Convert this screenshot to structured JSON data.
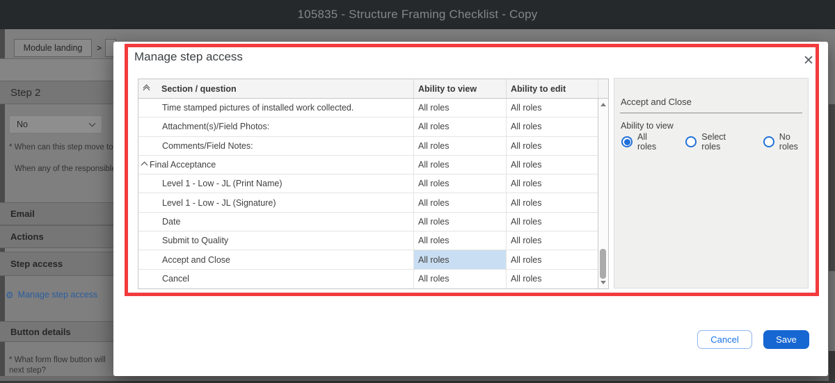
{
  "titlebar": {
    "title": "105835 - Structure Framing Checklist - Copy"
  },
  "background": {
    "breadcrumb": {
      "item": "Module landing",
      "separator": ">"
    },
    "step_heading": "Step 2",
    "dropdown_value": "No",
    "question_truncated": "* When can this step move to",
    "answer_truncated": "When any of the responsible",
    "section_email": "Email",
    "section_actions": "Actions",
    "section_step_access": "Step access",
    "manage_step_access_link": "Manage step access",
    "section_button_details": "Button details",
    "question2_line1": "* What form flow button will",
    "question2_line2": "next step?"
  },
  "icons": {
    "gear": "⚙",
    "close": "✕"
  },
  "modal": {
    "title": "Manage step access",
    "table": {
      "columns": [
        "Section / question",
        "Ability to view",
        "Ability to edit"
      ],
      "rows": [
        {
          "label": "Time stamped pictures of installed work collected.",
          "view": "All roles",
          "edit": "All roles",
          "section": false,
          "view_selected": false
        },
        {
          "label": "Attachment(s)/Field Photos:",
          "view": "All roles",
          "edit": "All roles",
          "section": false,
          "view_selected": false
        },
        {
          "label": "Comments/Field Notes:",
          "view": "All roles",
          "edit": "All roles",
          "section": false,
          "view_selected": false
        },
        {
          "label": "Final Acceptance",
          "view": "All roles",
          "edit": "All roles",
          "section": true,
          "view_selected": false
        },
        {
          "label": "Level 1 - Low - JL (Print Name)",
          "view": "All roles",
          "edit": "All roles",
          "section": false,
          "view_selected": false
        },
        {
          "label": "Level 1 - Low - JL (Signature)",
          "view": "All roles",
          "edit": "All roles",
          "section": false,
          "view_selected": false
        },
        {
          "label": "Date",
          "view": "All roles",
          "edit": "All roles",
          "section": false,
          "view_selected": false
        },
        {
          "label": "Submit to Quality",
          "view": "All roles",
          "edit": "All roles",
          "section": false,
          "view_selected": false
        },
        {
          "label": "Accept and Close",
          "view": "All roles",
          "edit": "All roles",
          "section": false,
          "view_selected": true
        },
        {
          "label": "Cancel",
          "view": "All roles",
          "edit": "All roles",
          "section": false,
          "view_selected": false
        }
      ]
    },
    "panel": {
      "title": "Accept and Close",
      "field_label": "Ability to view",
      "options": [
        {
          "label": "All roles",
          "selected": true
        },
        {
          "label": "Select roles",
          "selected": false
        },
        {
          "label": "No roles",
          "selected": false
        }
      ]
    },
    "buttons": {
      "cancel": "Cancel",
      "save": "Save"
    }
  },
  "colors": {
    "accent_blue": "#1a73e8",
    "save_blue": "#1667d2",
    "annotation_red": "#f23b3e",
    "highlight_cell": "#c9def2",
    "titlebar_bg": "#26292c"
  }
}
